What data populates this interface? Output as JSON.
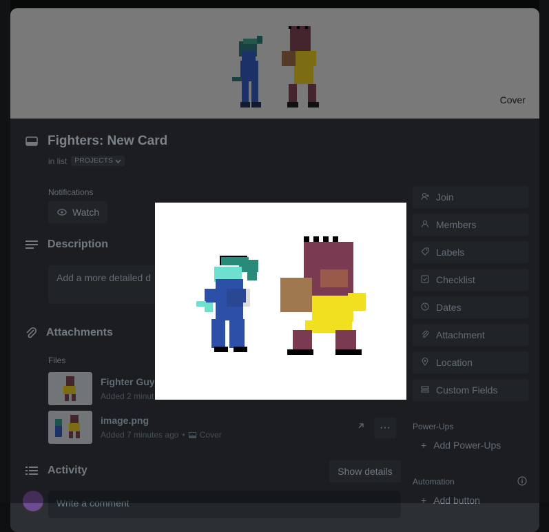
{
  "card": {
    "title": "Fighters: New Card",
    "in_list_prefix": "in list",
    "list_name": "PROJECTS",
    "cover_label": "Cover"
  },
  "notifications": {
    "label": "Notifications",
    "watch_label": "Watch"
  },
  "description": {
    "heading": "Description",
    "placeholder": "Add a more detailed d"
  },
  "attachments": {
    "heading": "Attachments",
    "files_label": "Files",
    "files": [
      {
        "name": "Fighter Guy_",
        "meta": "Added 2 minut"
      },
      {
        "name": "image.png",
        "meta": "Added 7 minutes ago",
        "cover_tag": "Cover"
      }
    ]
  },
  "activity": {
    "heading": "Activity",
    "show_details": "Show details",
    "comment_placeholder": "Write a comment"
  },
  "sidebar": {
    "actions": [
      {
        "label": "Join",
        "icon": "user-plus-icon"
      },
      {
        "label": "Members",
        "icon": "user-icon"
      },
      {
        "label": "Labels",
        "icon": "tag-icon"
      },
      {
        "label": "Checklist",
        "icon": "checkbox-icon"
      },
      {
        "label": "Dates",
        "icon": "clock-icon"
      },
      {
        "label": "Attachment",
        "icon": "paperclip-icon"
      },
      {
        "label": "Location",
        "icon": "location-pin-icon"
      },
      {
        "label": "Custom Fields",
        "icon": "fields-icon"
      }
    ],
    "powerups_label": "Power-Ups",
    "add_powerups": "Add Power-Ups",
    "automation_label": "Automation",
    "add_button": "Add button"
  },
  "colors": {
    "modal_bg": "#2c3035",
    "cover_bg": "#c4c4c4",
    "button_bg": "#353a40",
    "text": "#b6c2cf"
  }
}
